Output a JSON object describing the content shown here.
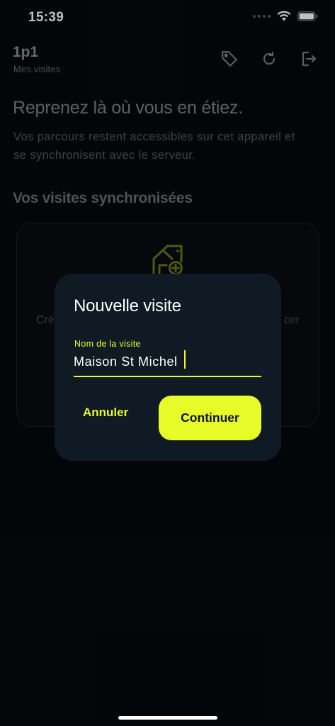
{
  "status_bar": {
    "time": "15:39"
  },
  "header": {
    "title": "1p1",
    "subtitle": "Mes visites",
    "actions": [
      {
        "name": "tag-button",
        "icon": "tag-icon"
      },
      {
        "name": "refresh-button",
        "icon": "refresh-icon"
      },
      {
        "name": "logout-button",
        "icon": "logout-icon"
      }
    ]
  },
  "main": {
    "hero_title": "Reprenez là où vous en étiez.",
    "hero_text": "Vos parcours restent accessibles sur cet appareil et se synchronisent avec le serveur.",
    "section_title": "Vos visites synchronisées",
    "empty_state": {
      "icon": "add-home-icon",
      "text_left": "Cré",
      "text_right": "cer"
    }
  },
  "dialog": {
    "title": "Nouvelle visite",
    "field_label": "Nom de la visite",
    "field_value": "Maison St Michel",
    "cancel_label": "Annuler",
    "continue_label": "Continuer"
  },
  "colors": {
    "accent": "#e8fc2a",
    "background": "#05080c",
    "dialog": "#0f1a25"
  }
}
